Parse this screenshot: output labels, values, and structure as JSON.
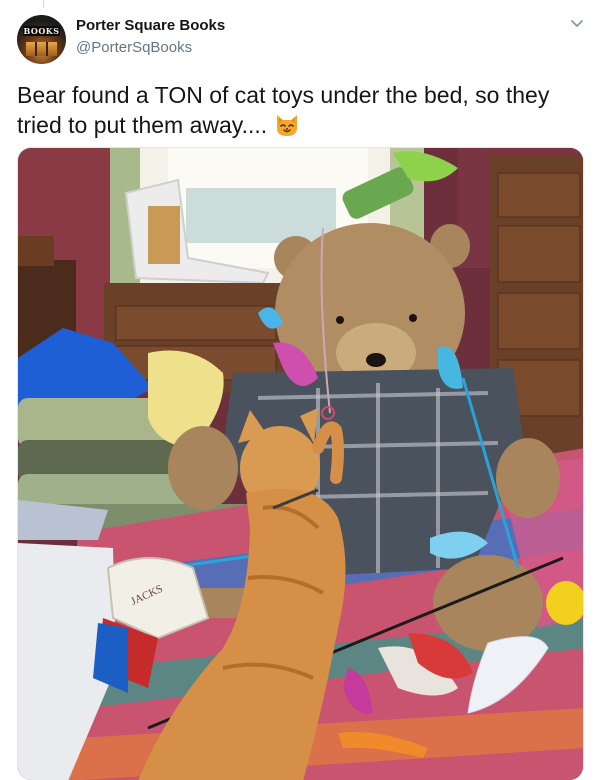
{
  "account": {
    "display_name": "Porter Square Books",
    "handle": "@PorterSqBooks",
    "avatar_sign_text": "BOOKS"
  },
  "tweet": {
    "text": "Bear found a TON of cat toys under the bed, so they tried to put them away....",
    "emoji": "cat-face-emoji"
  },
  "photo": {
    "toy_box_text": "JACKS"
  },
  "icons": {
    "menu": "chevron-down-icon"
  },
  "colors": {
    "name_text": "#14171a",
    "handle_text": "#657786"
  }
}
